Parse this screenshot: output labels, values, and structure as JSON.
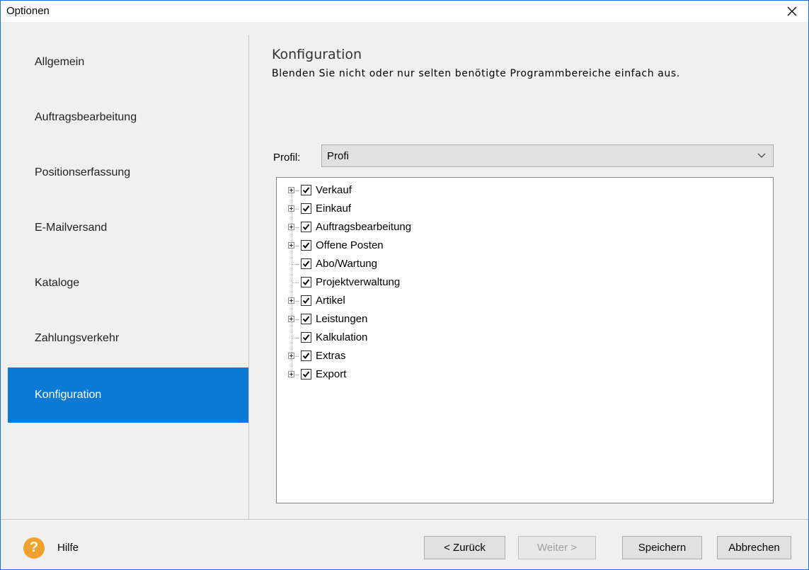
{
  "window": {
    "title": "Optionen"
  },
  "sidebar": {
    "items": [
      {
        "label": "Allgemein",
        "active": false
      },
      {
        "label": "Auftragsbearbeitung",
        "active": false
      },
      {
        "label": "Positionserfassung",
        "active": false
      },
      {
        "label": "E-Mailversand",
        "active": false
      },
      {
        "label": "Kataloge",
        "active": false
      },
      {
        "label": "Zahlungsverkehr",
        "active": false
      },
      {
        "label": "Konfiguration",
        "active": true
      }
    ]
  },
  "main": {
    "heading": "Konfiguration",
    "subheading": "Blenden Sie nicht oder nur selten benötigte Programmbereiche einfach aus.",
    "profil": {
      "label": "Profil:",
      "value": "Profi"
    },
    "tree": [
      {
        "label": "Verkauf",
        "expandable": true,
        "checked": true
      },
      {
        "label": "Einkauf",
        "expandable": true,
        "checked": true
      },
      {
        "label": "Auftragsbearbeitung",
        "expandable": true,
        "checked": true
      },
      {
        "label": "Offene Posten",
        "expandable": true,
        "checked": true
      },
      {
        "label": "Abo/Wartung",
        "expandable": false,
        "checked": true
      },
      {
        "label": "Projektverwaltung",
        "expandable": false,
        "checked": true
      },
      {
        "label": "Artikel",
        "expandable": true,
        "checked": true
      },
      {
        "label": "Leistungen",
        "expandable": true,
        "checked": true
      },
      {
        "label": "Kalkulation",
        "expandable": false,
        "checked": true
      },
      {
        "label": "Extras",
        "expandable": true,
        "checked": true
      },
      {
        "label": "Export",
        "expandable": true,
        "checked": true
      }
    ]
  },
  "footer": {
    "help_label": "Hilfe",
    "help_icon": "?",
    "buttons": {
      "back": "< Zurück",
      "next": "Weiter >",
      "save": "Speichern",
      "cancel": "Abbrechen"
    }
  },
  "colors": {
    "accent": "#0a7ad4",
    "help": "#f0a22c"
  }
}
